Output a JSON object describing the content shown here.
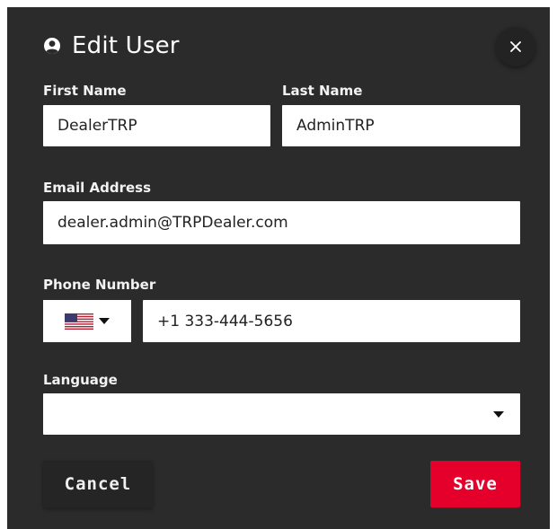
{
  "dialog": {
    "title": "Edit User",
    "title_icon": "user-circle-icon",
    "close_icon": "close-icon"
  },
  "form": {
    "first_name": {
      "label": "First Name",
      "value": "DealerTRP"
    },
    "last_name": {
      "label": "Last Name",
      "value": "AdminTRP"
    },
    "email": {
      "label": "Email Address",
      "value": "dealer.admin@TRPDealer.com"
    },
    "phone": {
      "label": "Phone Number",
      "country_flag": "us-flag-icon",
      "value": "+1 333-444-5656"
    },
    "language": {
      "label": "Language",
      "value": ""
    }
  },
  "actions": {
    "cancel_label": "Cancel",
    "save_label": "Save"
  },
  "colors": {
    "dialog_bg": "#2b2b2b",
    "save_bg": "#e4002b",
    "cancel_bg": "#252525"
  }
}
